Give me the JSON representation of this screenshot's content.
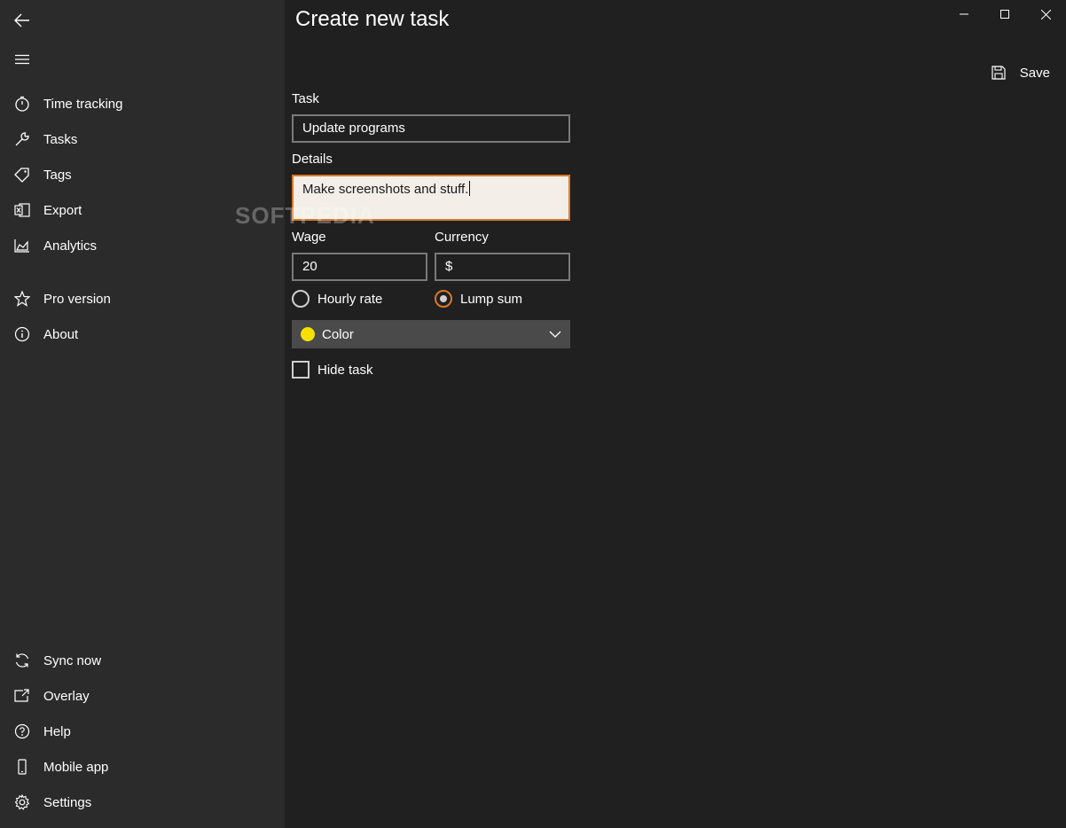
{
  "header": {
    "title": "Create new task",
    "save_label": "Save"
  },
  "sidebar": {
    "items": [
      {
        "label": "Time tracking",
        "icon": "stopwatch-icon"
      },
      {
        "label": "Tasks",
        "icon": "wrench-icon"
      },
      {
        "label": "Tags",
        "icon": "tag-icon"
      },
      {
        "label": "Export",
        "icon": "excel-icon"
      },
      {
        "label": "Analytics",
        "icon": "area-chart-icon"
      },
      {
        "label": "Pro version",
        "icon": "star-icon"
      },
      {
        "label": "About",
        "icon": "info-icon"
      }
    ],
    "bottom_items": [
      {
        "label": "Sync now",
        "icon": "sync-icon"
      },
      {
        "label": "Overlay",
        "icon": "overlay-icon"
      },
      {
        "label": "Help",
        "icon": "help-icon"
      },
      {
        "label": "Mobile app",
        "icon": "phone-icon"
      },
      {
        "label": "Settings",
        "icon": "gear-icon"
      }
    ]
  },
  "form": {
    "task_label": "Task",
    "task_value": "Update programs",
    "details_label": "Details",
    "details_value": "Make screenshots and stuff.",
    "wage_label": "Wage",
    "wage_value": "20",
    "currency_label": "Currency",
    "currency_value": "$",
    "rate_options": [
      {
        "label": "Hourly rate",
        "checked": false
      },
      {
        "label": "Lump sum",
        "checked": true
      }
    ],
    "color_label": "Color",
    "color_value": "#f5e000",
    "hide_task_label": "Hide task",
    "hide_task_checked": false
  },
  "watermark": "SOFTPEDIA",
  "colors": {
    "accent": "#d8792a",
    "sidebar_bg": "#2b2b2b",
    "content_bg": "#202020"
  }
}
